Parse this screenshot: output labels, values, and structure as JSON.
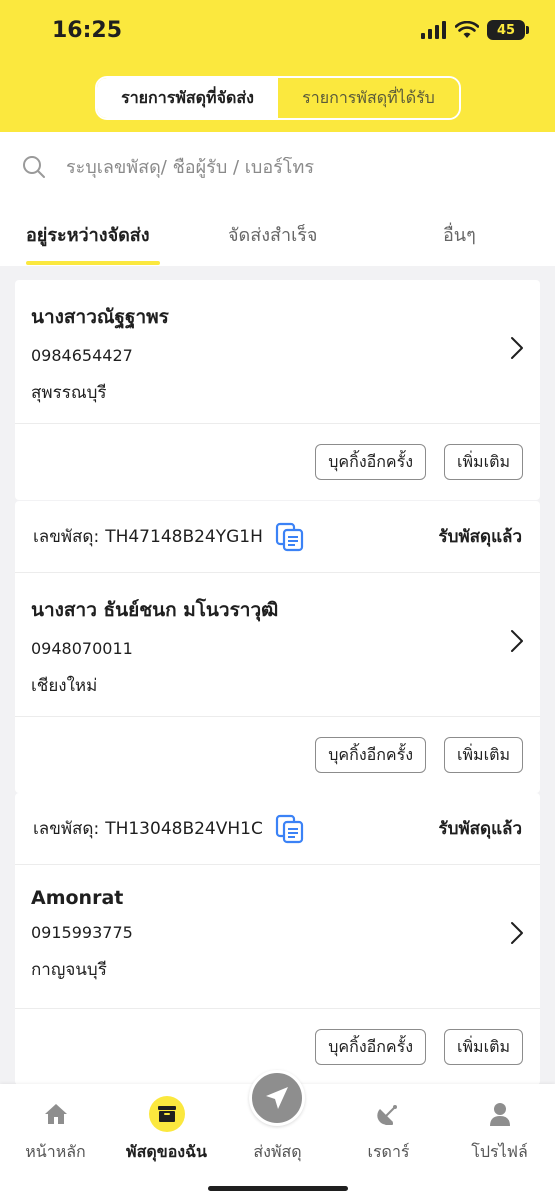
{
  "status_bar": {
    "time": "16:25",
    "battery": "45"
  },
  "segment": {
    "sent": "รายการพัสดุที่จัดส่ง",
    "received": "รายการพัสดุที่ได้รับ"
  },
  "search": {
    "placeholder": "ระบุเลขพัสดุ/ ชื่อผู้รับ / เบอร์โทร"
  },
  "tabs": [
    "อยู่ระหว่างจัดส่ง",
    "จัดส่งสำเร็จ",
    "อื่นๆ"
  ],
  "parcels": [
    {
      "name": "นางสาวณัฐฐาพร",
      "phone": "0984654427",
      "province": "สุพรรณบุรี",
      "rebook_label": "บุคกิ้งอีกครั้ง",
      "more_label": "เพิ่มเติม"
    },
    {
      "tracking_label": "เลขพัสดุ:",
      "tracking": "TH47148B24YG1H",
      "status": "รับพัสดุแล้ว",
      "name": "นางสาว ธันย์ชนก มโนวราวุฒิ",
      "phone": "0948070011",
      "province": "เชียงใหม่",
      "rebook_label": "บุคกิ้งอีกครั้ง",
      "more_label": "เพิ่มเติม"
    },
    {
      "tracking_label": "เลขพัสดุ:",
      "tracking": "TH13048B24VH1C",
      "status": "รับพัสดุแล้ว",
      "name": "Amonrat",
      "phone": "0915993775",
      "province": "กาญจนบุรี",
      "rebook_label": "บุคกิ้งอีกครั้ง",
      "more_label": "เพิ่มเติม"
    }
  ],
  "nav": [
    {
      "label": "หน้าหลัก",
      "icon": "home-icon"
    },
    {
      "label": "พัสดุของฉัน",
      "icon": "box-icon",
      "active": true
    },
    {
      "label": "ส่งพัสดุ",
      "icon": "send-icon"
    },
    {
      "label": "เรดาร์",
      "icon": "radar-icon"
    },
    {
      "label": "โปรไฟล์",
      "icon": "profile-icon"
    }
  ],
  "colors": {
    "brand_yellow": "#fbe83e",
    "copy_blue": "#3b82f6",
    "nav_gray": "#8e8e8e"
  }
}
